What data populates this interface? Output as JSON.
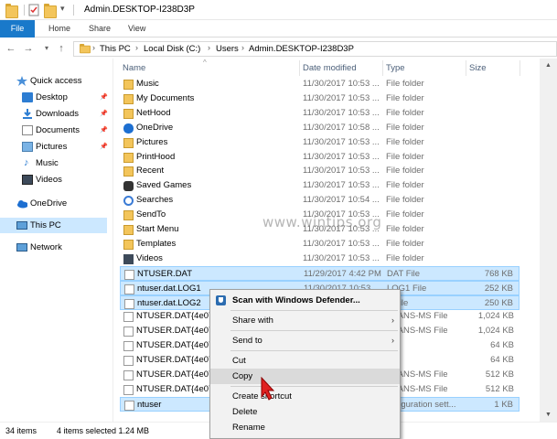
{
  "window": {
    "title": "Admin.DESKTOP-I238D3P"
  },
  "ribbon": {
    "tabs": [
      "File",
      "Home",
      "Share",
      "View"
    ]
  },
  "address": {
    "crumbs": [
      "This PC",
      "Local Disk (C:)",
      "Users",
      "Admin.DESKTOP-I238D3P"
    ]
  },
  "nav": {
    "quick_access": "Quick access",
    "items": [
      {
        "label": "Desktop",
        "icon": "desktop-icon",
        "pinned": true
      },
      {
        "label": "Downloads",
        "icon": "downloads-icon",
        "pinned": true
      },
      {
        "label": "Documents",
        "icon": "documents-icon",
        "pinned": true
      },
      {
        "label": "Pictures",
        "icon": "pictures-icon",
        "pinned": true
      },
      {
        "label": "Music",
        "icon": "music-icon",
        "pinned": false
      },
      {
        "label": "Videos",
        "icon": "videos-icon",
        "pinned": false
      }
    ],
    "onedrive": "OneDrive",
    "this_pc": "This PC",
    "network": "Network"
  },
  "columns": {
    "name": "Name",
    "date": "Date modified",
    "type": "Type",
    "size": "Size"
  },
  "files": [
    {
      "name": "Music",
      "date": "11/30/2017 10:53 ...",
      "type": "File folder",
      "size": "",
      "kind": "link",
      "selected": false
    },
    {
      "name": "My Documents",
      "date": "11/30/2017 10:53 ...",
      "type": "File folder",
      "size": "",
      "kind": "link",
      "selected": false
    },
    {
      "name": "NetHood",
      "date": "11/30/2017 10:53 ...",
      "type": "File folder",
      "size": "",
      "kind": "link",
      "selected": false
    },
    {
      "name": "OneDrive",
      "date": "11/30/2017 10:58 ...",
      "type": "File folder",
      "size": "",
      "kind": "onedrive",
      "selected": false
    },
    {
      "name": "Pictures",
      "date": "11/30/2017 10:53 ...",
      "type": "File folder",
      "size": "",
      "kind": "link",
      "selected": false
    },
    {
      "name": "PrintHood",
      "date": "11/30/2017 10:53 ...",
      "type": "File folder",
      "size": "",
      "kind": "link",
      "selected": false
    },
    {
      "name": "Recent",
      "date": "11/30/2017 10:53 ...",
      "type": "File folder",
      "size": "",
      "kind": "link",
      "selected": false
    },
    {
      "name": "Saved Games",
      "date": "11/30/2017 10:53 ...",
      "type": "File folder",
      "size": "",
      "kind": "games",
      "selected": false
    },
    {
      "name": "Searches",
      "date": "11/30/2017 10:54 ...",
      "type": "File folder",
      "size": "",
      "kind": "search",
      "selected": false
    },
    {
      "name": "SendTo",
      "date": "11/30/2017 10:53 ...",
      "type": "File folder",
      "size": "",
      "kind": "link",
      "selected": false
    },
    {
      "name": "Start Menu",
      "date": "11/30/2017 10:53 ...",
      "type": "File folder",
      "size": "",
      "kind": "link",
      "selected": false
    },
    {
      "name": "Templates",
      "date": "11/30/2017 10:53 ...",
      "type": "File folder",
      "size": "",
      "kind": "link",
      "selected": false
    },
    {
      "name": "Videos",
      "date": "11/30/2017 10:53 ...",
      "type": "File folder",
      "size": "",
      "kind": "videos",
      "selected": false
    },
    {
      "name": "NTUSER.DAT",
      "date": "11/29/2017 4:42 PM",
      "type": "DAT File",
      "size": "768 KB",
      "kind": "file",
      "selected": true
    },
    {
      "name": "ntuser.dat.LOG1",
      "date": "11/30/2017 10:53 ...",
      "type": "LOG1 File",
      "size": "252 KB",
      "kind": "file",
      "selected": true
    },
    {
      "name": "ntuser.dat.LOG2",
      "date": "",
      "type": "2 File",
      "size": "250 KB",
      "kind": "file",
      "selected": true
    },
    {
      "name": "NTUSER.DAT{4e074",
      "date": "",
      "type": "TRANS-MS File",
      "size": "1,024 KB",
      "kind": "file",
      "selected": false
    },
    {
      "name": "NTUSER.DAT{4e074",
      "date": "",
      "type": "TRANS-MS File",
      "size": "1,024 KB",
      "kind": "file",
      "selected": false
    },
    {
      "name": "NTUSER.DAT{4e074",
      "date": "",
      "type": "File",
      "size": "64 KB",
      "kind": "file",
      "selected": false
    },
    {
      "name": "NTUSER.DAT{4e074",
      "date": "",
      "type": "File",
      "size": "64 KB",
      "kind": "file",
      "selected": false
    },
    {
      "name": "NTUSER.DAT{4e074",
      "date": "",
      "type": "TRANS-MS File",
      "size": "512 KB",
      "kind": "file",
      "selected": false
    },
    {
      "name": "NTUSER.DAT{4e074",
      "date": "",
      "type": "TRANS-MS File",
      "size": "512 KB",
      "kind": "file",
      "selected": false
    },
    {
      "name": "ntuser",
      "date": "",
      "type": "onfiguration sett...",
      "size": "1 KB",
      "kind": "file",
      "selected": true
    }
  ],
  "context_menu": {
    "scan": "Scan with Windows Defender...",
    "share_with": "Share with",
    "send_to": "Send to",
    "cut": "Cut",
    "copy": "Copy",
    "create_shortcut": "Create shortcut",
    "delete": "Delete",
    "rename": "Rename"
  },
  "status": {
    "count": "34 items",
    "selected": "4 items selected  1.24 MB"
  },
  "watermark": "www.wintips.org",
  "colors": {
    "file_tab": "#1979ca",
    "selection": "#cce8ff",
    "folder": "#f3c55b",
    "cursor": "#e02020"
  }
}
